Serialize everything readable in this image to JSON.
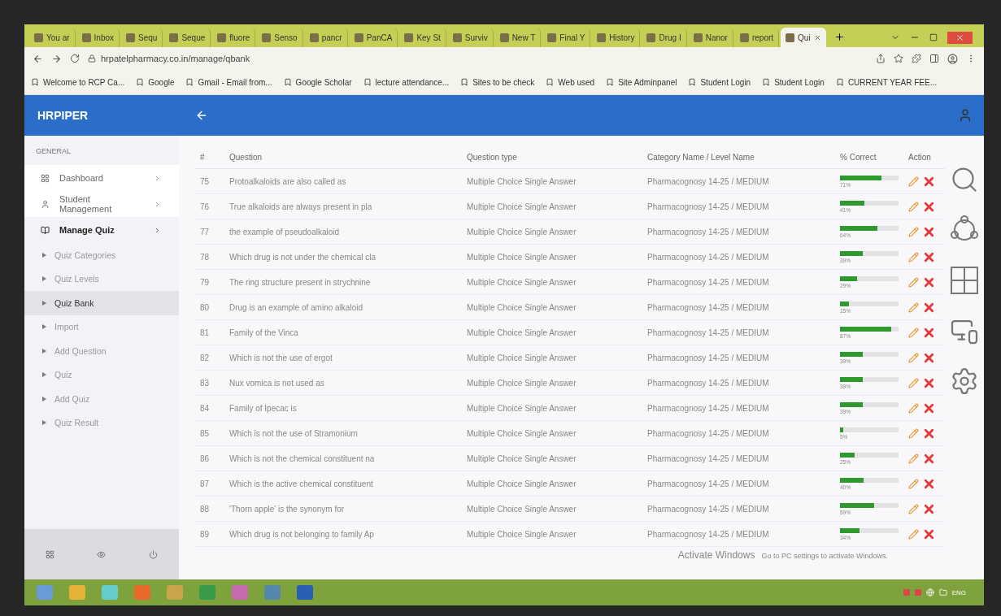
{
  "browser": {
    "tabs": [
      {
        "title": "You ar",
        "selected": false
      },
      {
        "title": "Inbox",
        "selected": false
      },
      {
        "title": "Sequ",
        "selected": false
      },
      {
        "title": "Seque",
        "selected": false
      },
      {
        "title": "fluore",
        "selected": false
      },
      {
        "title": "Senso",
        "selected": false
      },
      {
        "title": "pancr",
        "selected": false
      },
      {
        "title": "PanCA",
        "selected": false
      },
      {
        "title": "Key St",
        "selected": false
      },
      {
        "title": "Surviv",
        "selected": false
      },
      {
        "title": "New T",
        "selected": false
      },
      {
        "title": "Final Y",
        "selected": false
      },
      {
        "title": "History",
        "selected": false
      },
      {
        "title": "Drug I",
        "selected": false
      },
      {
        "title": "Nanor",
        "selected": false
      },
      {
        "title": "report",
        "selected": false
      },
      {
        "title": "Qui",
        "selected": true
      }
    ],
    "address": "hrpatelpharmacy.co.in/manage/qbank",
    "bookmarks": [
      "Welcome to RCP Ca...",
      "Google",
      "Gmail - Email from...",
      "Google Scholar",
      "lecture attendance...",
      "Sites to be check",
      "Web used",
      "Site Adminpanel",
      "Student Login",
      "Student Login",
      "CURRENT YEAR FEE..."
    ]
  },
  "app": {
    "brand": "HRPIPER"
  },
  "sidebar": {
    "section": "GENERAL",
    "items": [
      {
        "label": "Dashboard",
        "expanded": false
      },
      {
        "label": "Student Management",
        "expanded": false
      },
      {
        "label": "Manage Quiz",
        "expanded": true,
        "children": [
          {
            "label": "Quiz Categories",
            "selected": false
          },
          {
            "label": "Quiz Levels",
            "selected": false
          },
          {
            "label": "Quiz Bank",
            "selected": true
          },
          {
            "label": "Import",
            "selected": false
          },
          {
            "label": "Add Question",
            "selected": false
          },
          {
            "label": "Quiz",
            "selected": false
          },
          {
            "label": "Add Quiz",
            "selected": false
          },
          {
            "label": "Quiz Result",
            "selected": false
          }
        ]
      }
    ]
  },
  "table": {
    "columns": [
      "#",
      "Question",
      "Question type",
      "Category Name / Level Name",
      "% Correct",
      "Action"
    ],
    "rows": [
      {
        "number": "75",
        "question": "Protoalkaloids are also called as",
        "type": "Multiple Choice Single Answer",
        "category": "Pharmacognosy 14-25 / MEDIUM",
        "reading": "71%",
        "level": 0.71
      },
      {
        "number": "76",
        "question": "True alkaloids are always present in pla",
        "type": "Multiple Choice Single Answer",
        "category": "Pharmacognosy 14-25 / MEDIUM",
        "reading": "41%",
        "level": 0.41
      },
      {
        "number": "77",
        "question": "the example of pseudoalkaloid",
        "type": "Multiple Choice Single Answer",
        "category": "Pharmacognosy 14-25 / MEDIUM",
        "reading": "64%",
        "level": 0.64
      },
      {
        "number": "78",
        "question": "Which drug is not under the chemical cla",
        "type": "Multiple Choice Single Answer",
        "category": "Pharmacognosy 14-25 / MEDIUM",
        "reading": "39%",
        "level": 0.39
      },
      {
        "number": "79",
        "question": "The ring structure present in strychnine",
        "type": "Multiple Choice Single Answer",
        "category": "Pharmacognosy 14-25 / MEDIUM",
        "reading": "29%",
        "level": 0.29
      },
      {
        "number": "80",
        "question": "Drug is an example of amino alkaloid",
        "type": "Multiple Choice Single Answer",
        "category": "Pharmacognosy 14-25 / MEDIUM",
        "reading": "15%",
        "level": 0.15
      },
      {
        "number": "81",
        "question": "Family of the Vinca",
        "type": "Multiple Choice Single Answer",
        "category": "Pharmacognosy 14-25 / MEDIUM",
        "reading": "87%",
        "level": 0.87
      },
      {
        "number": "82",
        "question": "Which is not the use of ergot",
        "type": "Multiple Choice Single Answer",
        "category": "Pharmacognosy 14-25 / MEDIUM",
        "reading": "39%",
        "level": 0.39
      },
      {
        "number": "83",
        "question": "Nux vomica is not used as",
        "type": "Multiple Choice Single Answer",
        "category": "Pharmacognosy 14-25 / MEDIUM",
        "reading": "39%",
        "level": 0.39
      },
      {
        "number": "84",
        "question": "Family of Ipecac is",
        "type": "Multiple Choice Single Answer",
        "category": "Pharmacognosy 14-25 / MEDIUM",
        "reading": "39%",
        "level": 0.39
      },
      {
        "number": "85",
        "question": "Which is not the use of Stramonium",
        "type": "Multiple Choice Single Answer",
        "category": "Pharmacognosy 14-25 / MEDIUM",
        "reading": "5%",
        "level": 0.05
      },
      {
        "number": "86",
        "question": "Which is not the chemical constituent na",
        "type": "Multiple Choice Single Answer",
        "category": "Pharmacognosy 14-25 / MEDIUM",
        "reading": "25%",
        "level": 0.25
      },
      {
        "number": "87",
        "question": "Which is the active chemical constituent",
        "type": "Multiple Choice Single Answer",
        "category": "Pharmacognosy 14-25 / MEDIUM",
        "reading": "40%",
        "level": 0.4
      },
      {
        "number": "88",
        "question": "'Thorn apple' is the synonym for",
        "type": "Multiple Choice Single Answer",
        "category": "Pharmacognosy 14-25 / MEDIUM",
        "reading": "59%",
        "level": 0.59
      },
      {
        "number": "89",
        "question": "Which drug is not belonging to family Ap",
        "type": "Multiple Choice Single Answer",
        "category": "Pharmacognosy 14-25 / MEDIUM",
        "reading": "34%",
        "level": 0.34
      }
    ]
  },
  "activation": {
    "title": "Activate Windows",
    "hint": "Go to PC settings to activate Windows."
  },
  "taskbar": {
    "language": "ENG"
  }
}
